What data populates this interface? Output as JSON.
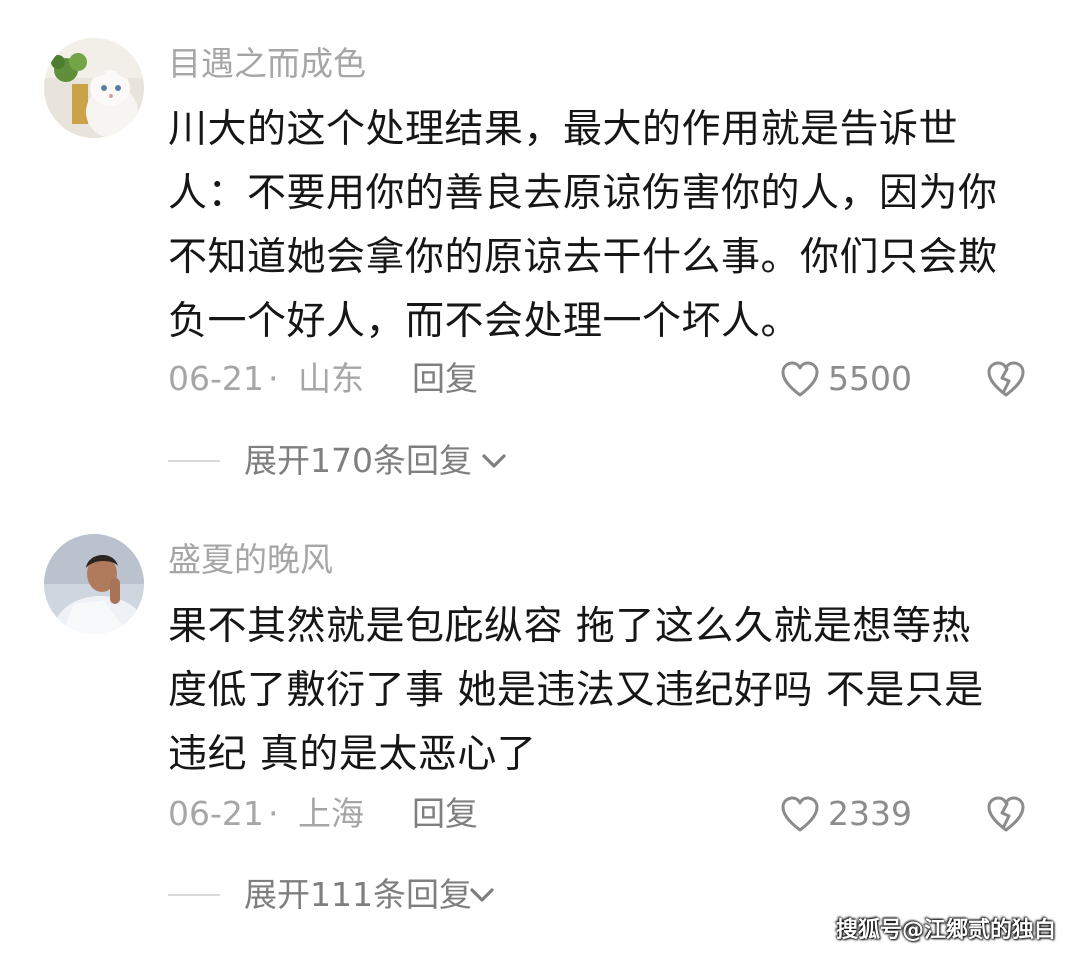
{
  "comments": [
    {
      "username": "目遇之而成色",
      "avatar": "cat-with-plant-avatar",
      "text_lines": [
        "川大的这个处理结果，最大的作用就是告诉世",
        "人：不要用你的善良去原谅伤害你的人，因为你",
        "不知道她会拿你的原谅去干什么事。你们只会欺",
        "负一个好人，而不会处理一个坏人。"
      ],
      "date": "06-21",
      "separator": "·",
      "location": "山东",
      "reply_label": "回复",
      "like_count": "5500",
      "like_icon": "heart-outline-icon",
      "dislike_icon": "broken-heart-icon",
      "expand_label": "展开170条回复"
    },
    {
      "username": "盛夏的晚风",
      "avatar": "person-photo-avatar",
      "text_lines": [
        "果不其然就是包庇纵容 拖了这么久就是想等热",
        "度低了敷衍了事 她是违法又违纪好吗 不是只是",
        "违纪 真的是太恶心了"
      ],
      "date": "06-21",
      "separator": "·",
      "location": "上海",
      "reply_label": "回复",
      "like_count": "2339",
      "like_icon": "heart-outline-icon",
      "dislike_icon": "broken-heart-icon",
      "expand_label": "展开111条回复"
    }
  ],
  "watermark": "搜狐号@江郷贰的独白",
  "colors": {
    "text": "#161616",
    "muted": "#a6a6a6",
    "icon": "#8c8c8c",
    "divider": "#d9d9d9",
    "background": "#ffffff"
  }
}
